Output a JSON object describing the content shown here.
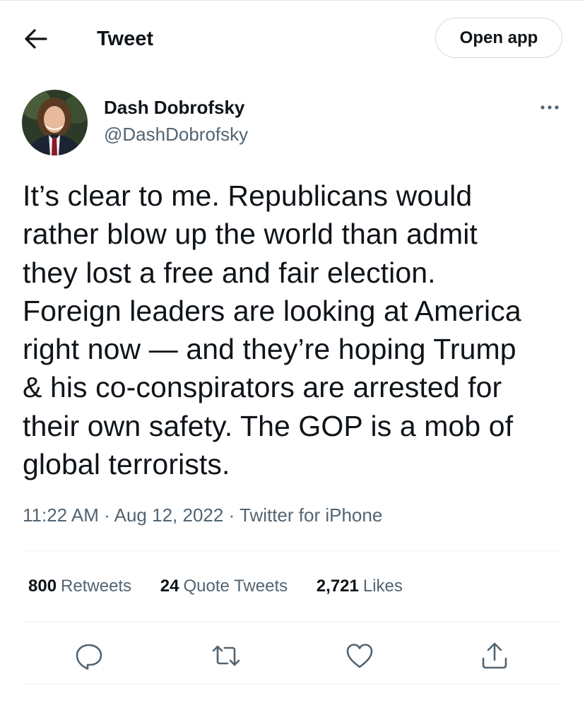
{
  "header": {
    "title": "Tweet",
    "open_app_label": "Open app"
  },
  "author": {
    "name": "Dash Dobrofsky",
    "handle": "@DashDobrofsky"
  },
  "tweet": {
    "lines": [
      "It’s clear to me. Republicans would",
      "rather blow up the world than admit",
      "they lost a free and fair election.",
      "Foreign leaders are looking at America",
      "right now — and they’re hoping Trump",
      "& his co-conspirators are arrested for",
      "their own safety. The GOP is a mob of",
      "global terrorists."
    ],
    "time": "11:22 AM",
    "date": "Aug 12, 2022",
    "source": "Twitter for iPhone"
  },
  "stats": {
    "retweets": {
      "count": "800",
      "label": "Retweets"
    },
    "quote_tweets": {
      "count": "24",
      "label": "Quote Tweets"
    },
    "likes": {
      "count": "2,721",
      "label": "Likes"
    }
  },
  "icons": {
    "back": "arrow-left-icon",
    "more": "more-icon",
    "reply": "reply-icon",
    "retweet": "retweet-icon",
    "like": "heart-icon",
    "share": "share-icon"
  },
  "colors": {
    "text": "#0f1419",
    "secondary": "#536471",
    "border": "#cfd9de",
    "divider": "#eff3f4"
  }
}
